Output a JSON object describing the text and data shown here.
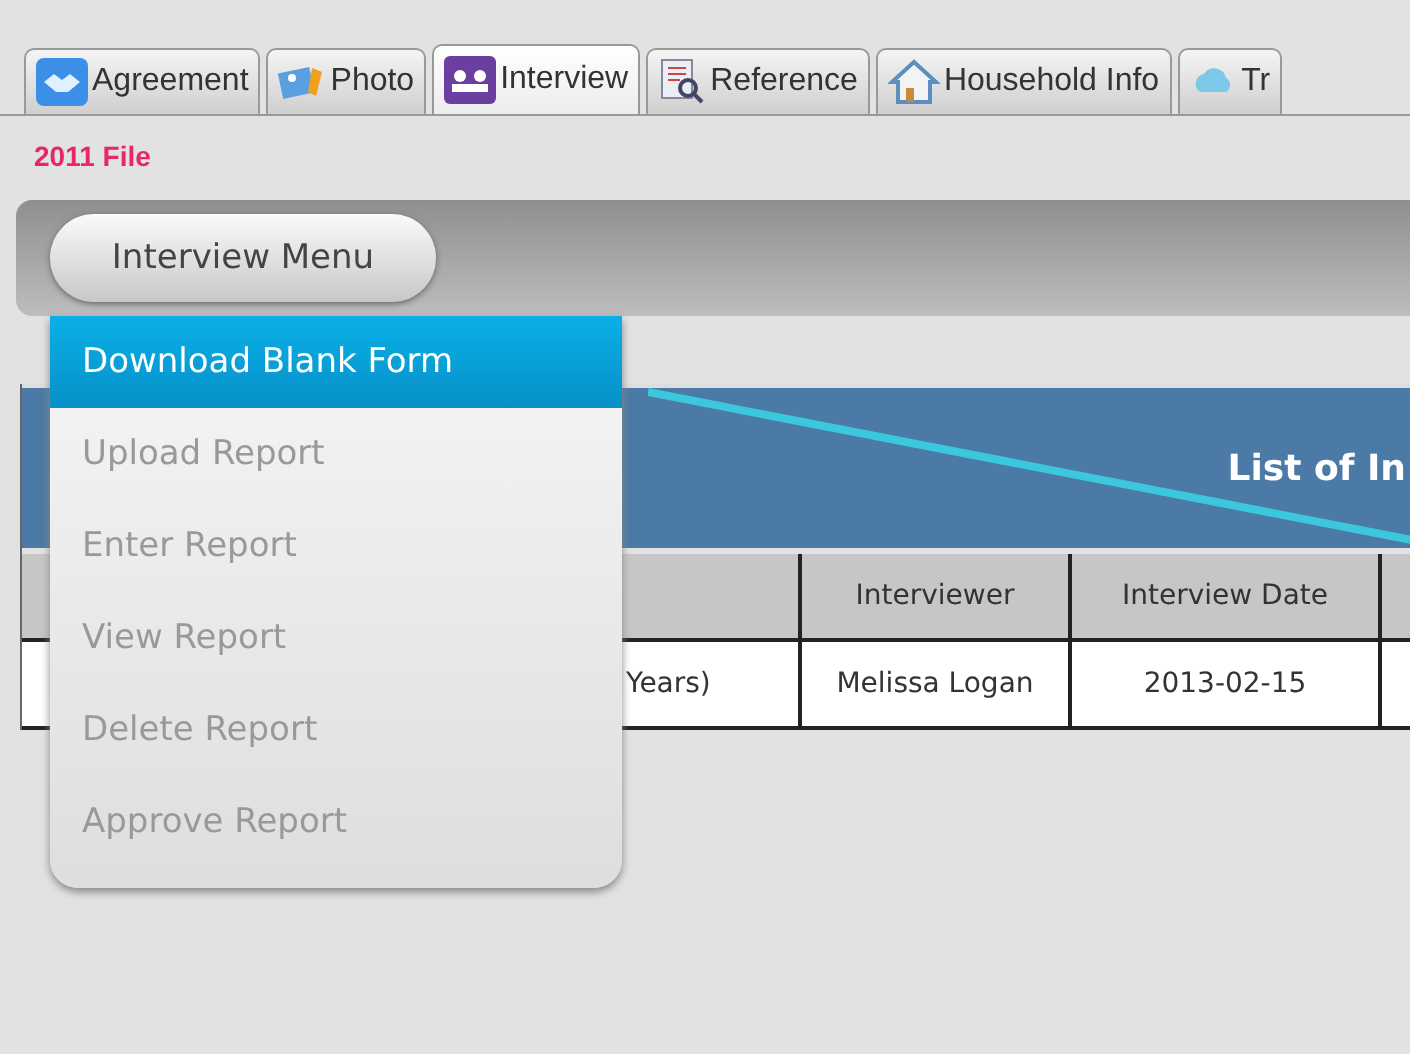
{
  "tabs": [
    {
      "label": "Agreement",
      "selected": false
    },
    {
      "label": "Photo",
      "selected": false
    },
    {
      "label": "Interview",
      "selected": true
    },
    {
      "label": "Reference",
      "selected": false
    },
    {
      "label": "Household Info",
      "selected": false
    },
    {
      "label": "Tr",
      "selected": false
    }
  ],
  "file_label": "2011 File",
  "menu_button": "Interview Menu",
  "menu_items": [
    {
      "label": "Download Blank Form",
      "selected": true,
      "disabled": false
    },
    {
      "label": "Upload Report",
      "selected": false,
      "disabled": true
    },
    {
      "label": "Enter Report",
      "selected": false,
      "disabled": true
    },
    {
      "label": "View Report",
      "selected": false,
      "disabled": true
    },
    {
      "label": "Delete Report",
      "selected": false,
      "disabled": true
    },
    {
      "label": "Approve Report",
      "selected": false,
      "disabled": true
    }
  ],
  "table": {
    "title": "List of In",
    "columns": [
      "Interviewer",
      "Interview Date"
    ],
    "rows": [
      {
        "column_1": "Years)",
        "interviewer": "Melissa Logan",
        "interview_date": "2013-02-15"
      }
    ]
  }
}
